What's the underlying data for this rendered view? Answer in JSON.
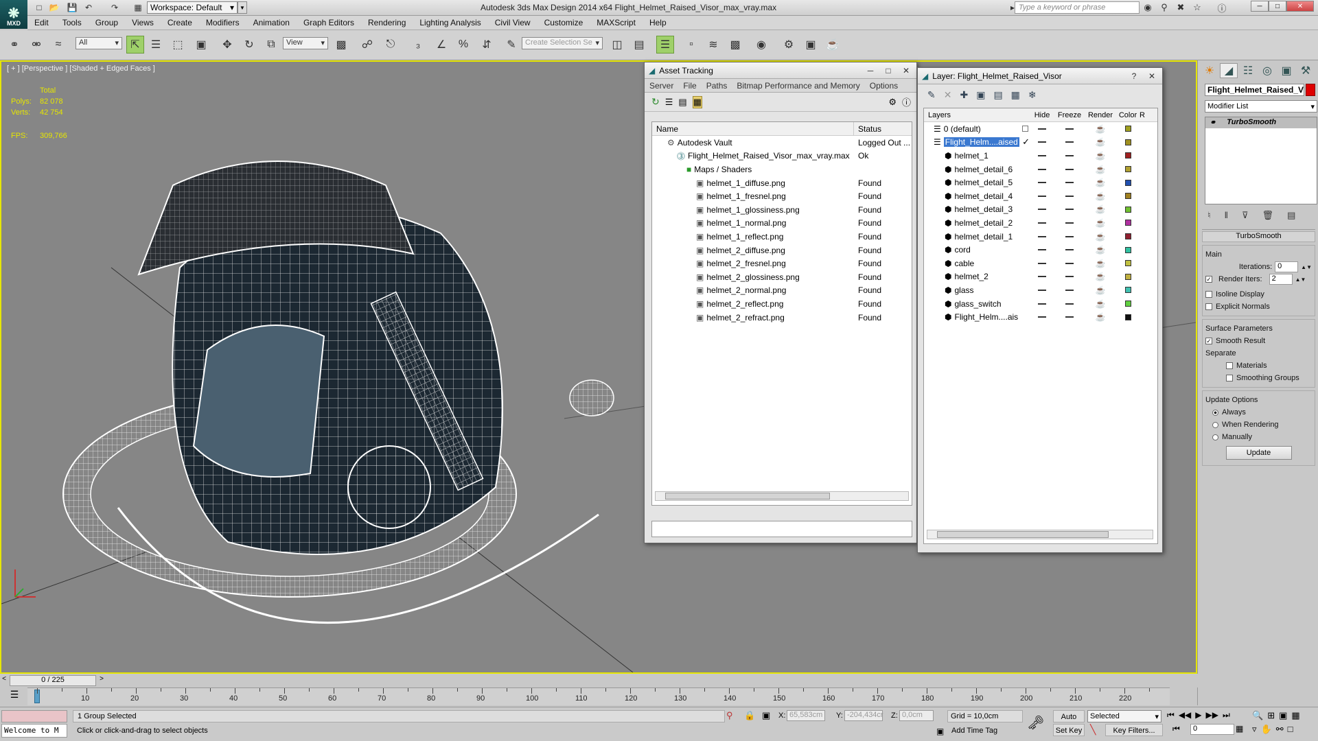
{
  "app": {
    "logo_label": "MXD",
    "workspace": "Workspace: Default",
    "title": "Autodesk 3ds Max Design 2014 x64      Flight_Helmet_Raised_Visor_max_vray.max",
    "search_placeholder": "Type a keyword or phrase"
  },
  "menu": [
    "Edit",
    "Tools",
    "Group",
    "Views",
    "Create",
    "Modifiers",
    "Animation",
    "Graph Editors",
    "Rendering",
    "Lighting Analysis",
    "Civil View",
    "Customize",
    "MAXScript",
    "Help"
  ],
  "toolbar": {
    "selection_filter": "All",
    "ref_coord": "View",
    "named_selection_placeholder": "Create Selection Se"
  },
  "viewport": {
    "label": "[ + ] [Perspective ] [Shaded + Edged Faces ]",
    "total_label": "Total",
    "polys_label": "Polys:",
    "polys_value": "82 078",
    "verts_label": "Verts:",
    "verts_value": "42 754",
    "fps_label": "FPS:",
    "fps_value": "309,766"
  },
  "asset_tracking": {
    "title": "Asset Tracking",
    "menu": [
      "Server",
      "File",
      "Paths",
      "Bitmap Performance and Memory",
      "Options"
    ],
    "col_name": "Name",
    "col_status": "Status",
    "rows": [
      {
        "name": "Autodesk Vault",
        "status": "Logged Out ...",
        "indent": 1,
        "icon": "vault"
      },
      {
        "name": "Flight_Helmet_Raised_Visor_max_vray.max",
        "status": "Ok",
        "indent": 2,
        "icon": "max"
      },
      {
        "name": "Maps / Shaders",
        "status": "",
        "indent": 3,
        "icon": "folder"
      },
      {
        "name": "helmet_1_diffuse.png",
        "status": "Found",
        "indent": 4,
        "icon": "img"
      },
      {
        "name": "helmet_1_fresnel.png",
        "status": "Found",
        "indent": 4,
        "icon": "img"
      },
      {
        "name": "helmet_1_glossiness.png",
        "status": "Found",
        "indent": 4,
        "icon": "img"
      },
      {
        "name": "helmet_1_normal.png",
        "status": "Found",
        "indent": 4,
        "icon": "img"
      },
      {
        "name": "helmet_1_reflect.png",
        "status": "Found",
        "indent": 4,
        "icon": "img"
      },
      {
        "name": "helmet_2_diffuse.png",
        "status": "Found",
        "indent": 4,
        "icon": "img"
      },
      {
        "name": "helmet_2_fresnel.png",
        "status": "Found",
        "indent": 4,
        "icon": "img"
      },
      {
        "name": "helmet_2_glossiness.png",
        "status": "Found",
        "indent": 4,
        "icon": "img"
      },
      {
        "name": "helmet_2_normal.png",
        "status": "Found",
        "indent": 4,
        "icon": "img"
      },
      {
        "name": "helmet_2_reflect.png",
        "status": "Found",
        "indent": 4,
        "icon": "img"
      },
      {
        "name": "helmet_2_refract.png",
        "status": "Found",
        "indent": 4,
        "icon": "img"
      }
    ]
  },
  "layer_manager": {
    "title": "Layer: Flight_Helmet_Raised_Visor",
    "col_layers": "Layers",
    "col_hide": "Hide",
    "col_freeze": "Freeze",
    "col_render": "Render",
    "col_color": "Color",
    "col_r": "R",
    "rows": [
      {
        "name": "0 (default)",
        "color": "#a0a020",
        "level": 0,
        "selected": false,
        "layer": true
      },
      {
        "name": "Flight_Helm....aised",
        "color": "#a09020",
        "level": 0,
        "selected": true,
        "layer": true
      },
      {
        "name": "helmet_1",
        "color": "#a02020",
        "level": 1,
        "selected": false,
        "layer": false
      },
      {
        "name": "helmet_detail_6",
        "color": "#b0a030",
        "level": 1,
        "selected": false,
        "layer": false
      },
      {
        "name": "helmet_detail_5",
        "color": "#2050b0",
        "level": 1,
        "selected": false,
        "layer": false
      },
      {
        "name": "helmet_detail_4",
        "color": "#a08020",
        "level": 1,
        "selected": false,
        "layer": false
      },
      {
        "name": "helmet_detail_3",
        "color": "#70c030",
        "level": 1,
        "selected": false,
        "layer": false
      },
      {
        "name": "helmet_detail_2",
        "color": "#b030a0",
        "level": 1,
        "selected": false,
        "layer": false
      },
      {
        "name": "helmet_detail_1",
        "color": "#902030",
        "level": 1,
        "selected": false,
        "layer": false
      },
      {
        "name": "cord",
        "color": "#30c0a0",
        "level": 1,
        "selected": false,
        "layer": false
      },
      {
        "name": "cable",
        "color": "#c0c040",
        "level": 1,
        "selected": false,
        "layer": false
      },
      {
        "name": "helmet_2",
        "color": "#c0b040",
        "level": 1,
        "selected": false,
        "layer": false
      },
      {
        "name": "glass",
        "color": "#40c0b0",
        "level": 1,
        "selected": false,
        "layer": false
      },
      {
        "name": "glass_switch",
        "color": "#60d040",
        "level": 1,
        "selected": false,
        "layer": false
      },
      {
        "name": "Flight_Helm....ais",
        "color": "#101010",
        "level": 1,
        "selected": false,
        "layer": false
      }
    ]
  },
  "command_panel": {
    "object_name": "Flight_Helmet_Raised_Vi",
    "modifier_list": "Modifier List",
    "stack_item": "TurboSmooth",
    "rollout_title": "TurboSmooth",
    "main_label": "Main",
    "iterations_label": "Iterations:",
    "iterations_value": "0",
    "render_iters_label": "Render Iters:",
    "render_iters_value": "2",
    "isoline_label": "Isoline Display",
    "explicit_normals_label": "Explicit Normals",
    "surface_params_label": "Surface Parameters",
    "smooth_result_label": "Smooth Result",
    "separate_label": "Separate",
    "materials_label": "Materials",
    "smoothing_groups_label": "Smoothing Groups",
    "update_options_label": "Update Options",
    "always_label": "Always",
    "when_rendering_label": "When Rendering",
    "manually_label": "Manually",
    "update_button": "Update"
  },
  "timeline": {
    "frame_counter": "0 / 225",
    "ticks": [
      "10",
      "20",
      "30",
      "40",
      "50",
      "60",
      "70",
      "80",
      "90",
      "100",
      "110",
      "120",
      "130",
      "140",
      "150",
      "160",
      "170",
      "180",
      "190",
      "200",
      "210",
      "220"
    ]
  },
  "status": {
    "maxscript": "Welcome to M",
    "selection": "1 Group Selected",
    "prompt": "Click or click-and-drag to select objects",
    "x_label": "X:",
    "x_value": "65,583cm",
    "y_label": "Y:",
    "y_value": "-204,434cr",
    "z_label": "Z:",
    "z_value": "0,0cm",
    "grid": "Grid = 10,0cm",
    "add_time_tag": "Add Time Tag",
    "auto_key": "Auto Key",
    "set_key": "Set Key",
    "selected": "Selected",
    "key_filters": "Key Filters...",
    "frame": "0"
  }
}
